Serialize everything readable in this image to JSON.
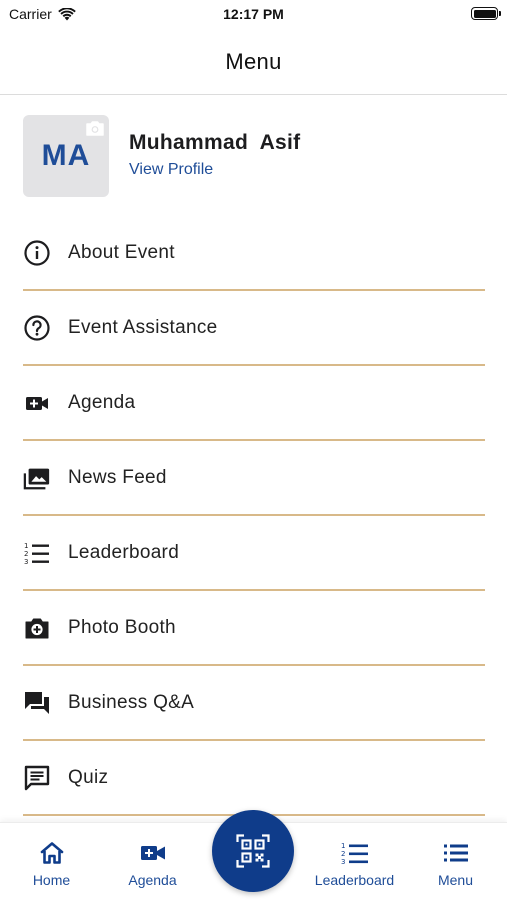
{
  "status_bar": {
    "carrier": "Carrier",
    "time": "12:17 PM"
  },
  "header": {
    "title": "Menu"
  },
  "profile": {
    "initials": "MA",
    "name": "Muhammad  Asif",
    "view_profile": "View Profile"
  },
  "menu": {
    "items": [
      {
        "label": "About Event",
        "icon": "info-icon"
      },
      {
        "label": "Event Assistance",
        "icon": "help-icon"
      },
      {
        "label": "Agenda",
        "icon": "video-camera-icon"
      },
      {
        "label": "News Feed",
        "icon": "photo-library-icon"
      },
      {
        "label": "Leaderboard",
        "icon": "numbered-list-icon"
      },
      {
        "label": "Photo Booth",
        "icon": "camera-plus-icon"
      },
      {
        "label": "Business Q&A",
        "icon": "forum-icon"
      },
      {
        "label": "Quiz",
        "icon": "message-text-icon"
      }
    ]
  },
  "tab_bar": {
    "tabs": [
      {
        "label": "Home",
        "icon": "home-icon"
      },
      {
        "label": "Agenda",
        "icon": "video-camera-icon"
      },
      {
        "label": "Leaderboard",
        "icon": "numbered-list-icon"
      },
      {
        "label": "Menu",
        "icon": "menu-list-icon"
      }
    ],
    "center_button_icon": "qr-scan-icon"
  },
  "colors": {
    "brand_blue": "#1f4d98",
    "fab_blue": "#0f3c8a",
    "divider_gold": "#d8b989",
    "avatar_bg": "#e3e3e5"
  }
}
